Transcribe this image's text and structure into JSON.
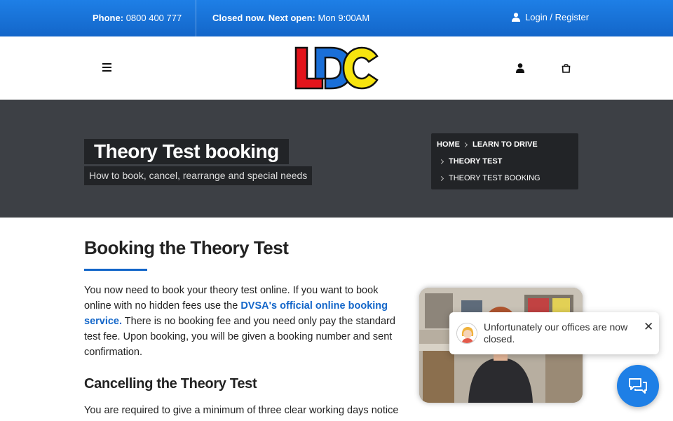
{
  "topbar": {
    "phone_label": "Phone:",
    "phone_number": "0800 400 777",
    "hours_label": "Closed now. Next open:",
    "hours_value": "Mon 9:00AM",
    "login_label": "Login / Register"
  },
  "header": {
    "logo_letters": [
      "L",
      "D",
      "C"
    ],
    "icons": [
      "hamburger-menu-icon",
      "user-icon",
      "shopping-bag-icon"
    ]
  },
  "hero": {
    "title": "Theory Test booking",
    "subtitle": "How to book, cancel, rearrange and special needs",
    "breadcrumb": {
      "home": "HOME",
      "learn": "LEARN TO DRIVE",
      "theory": "THEORY TEST",
      "current": "THEORY TEST BOOKING"
    }
  },
  "content": {
    "heading": "Booking the Theory Test",
    "para_part1": "You now need to book your theory test online. If you want to book online with no hidden fees use the ",
    "para_link": "DVSA's official online booking service.",
    "para_part2": " There is no booking fee and you need only pay the standard test fee. Upon booking, you will be given a booking number and sent confirmation.",
    "subheading": "Cancelling the Theory Test",
    "para2": "You are required to give a minimum of three clear working days notice"
  },
  "chat": {
    "message": "Unfortunately our offices are now closed.",
    "close_label": "✕"
  },
  "colors": {
    "primary_blue": "#1366c9",
    "hero_bg": "#3d4045",
    "logo_red": "#e3141b",
    "logo_blue": "#1a6fd8",
    "logo_yellow": "#f7e40f"
  }
}
